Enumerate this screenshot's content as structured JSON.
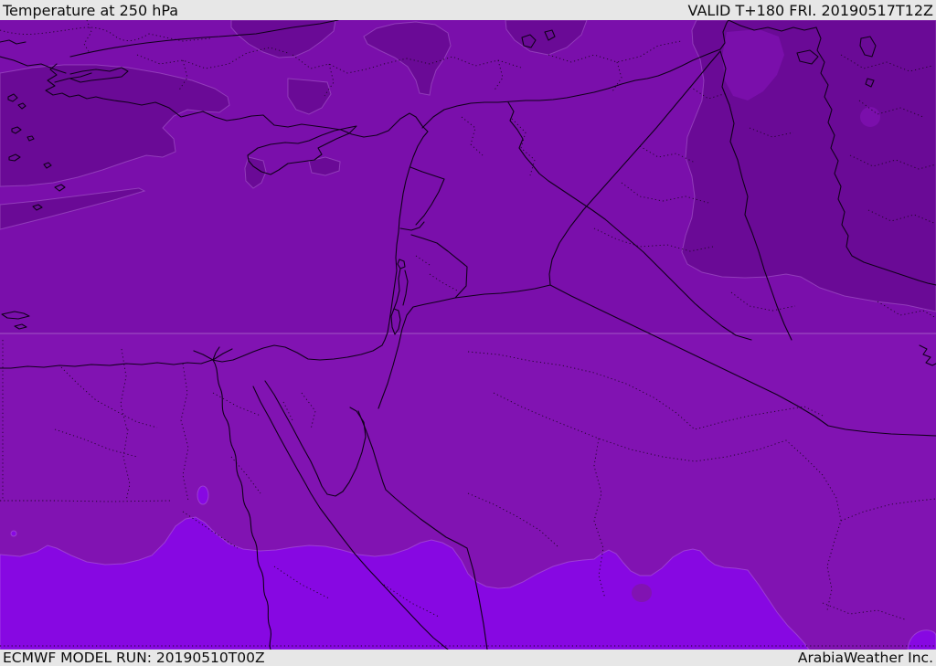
{
  "header": {
    "title": "Temperature at 250 hPa",
    "valid_label": "VALID T+180 FRI. 20190517T12Z"
  },
  "footer": {
    "model_run_label": "ECMWF MODEL RUN: 20190510T00Z",
    "credit": "ArabiaWeather Inc."
  },
  "map": {
    "parameter": "Temperature",
    "level": "250 hPa",
    "model": "ECMWF",
    "colors": {
      "bar_background": "#e7e7e7",
      "bar_text": "#0d0d0d",
      "band_coldest": "#6a0a96",
      "band_cold": "#7a0fab",
      "band_mild": "#8113b2",
      "band_warm": "#8708e2",
      "coastline": "#10001a",
      "admin_boundary": "#1e0526",
      "contour_light": "#bf8fd8"
    }
  }
}
